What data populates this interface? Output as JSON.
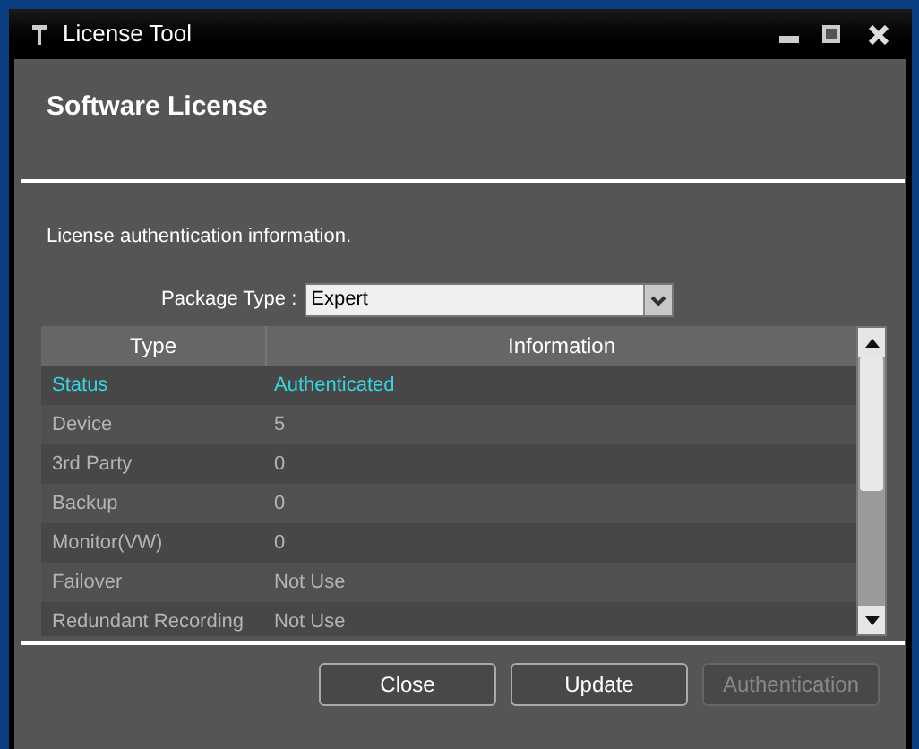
{
  "window": {
    "title": "License Tool"
  },
  "header": {
    "title": "Software License"
  },
  "description": "License authentication information.",
  "package_type": {
    "label": "Package Type :",
    "value": "Expert"
  },
  "table": {
    "columns": [
      "Type",
      "Information"
    ],
    "rows": [
      {
        "type": "Status",
        "information": "Authenticated",
        "highlighted": true
      },
      {
        "type": "Device",
        "information": "5",
        "highlighted": false
      },
      {
        "type": "3rd Party",
        "information": "0",
        "highlighted": false
      },
      {
        "type": "Backup",
        "information": "0",
        "highlighted": false
      },
      {
        "type": "Monitor(VW)",
        "information": "0",
        "highlighted": false
      },
      {
        "type": "Failover",
        "information": "Not Use",
        "highlighted": false
      },
      {
        "type": "Redundant Recording",
        "information": "Not Use",
        "highlighted": false
      }
    ]
  },
  "buttons": [
    {
      "label": "Close",
      "disabled": false
    },
    {
      "label": "Update",
      "disabled": false
    },
    {
      "label": "Authentication",
      "disabled": true
    }
  ]
}
